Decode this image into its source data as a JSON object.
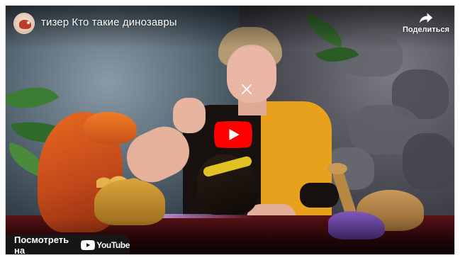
{
  "video": {
    "title": "тизер Кто такие динозавры",
    "channel_avatar_icon": "channel-avatar-dinosaur"
  },
  "share": {
    "label": "Поделиться",
    "icon": "share-arrow-icon"
  },
  "play_button": {
    "icon": "youtube-play-icon",
    "color": "#ff0000"
  },
  "watch_on": {
    "label": "Посмотреть на",
    "brand": "YouTube"
  },
  "colors": {
    "youtube_red": "#ff0000",
    "overlay_text": "#ffffff"
  }
}
